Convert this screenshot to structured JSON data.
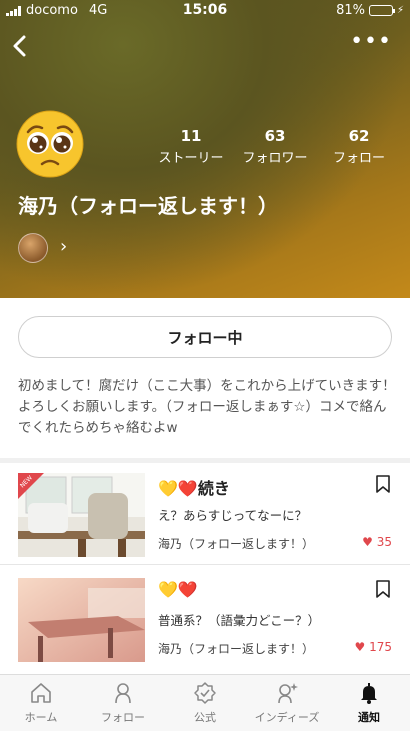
{
  "statusbar": {
    "carrier": "docomo",
    "network": "4G",
    "time": "15:06",
    "battery": "81%",
    "battery_level": 0.81
  },
  "profile": {
    "name": "海乃（フォロー返します！）",
    "stats": [
      {
        "value": "11",
        "label": "ストーリー"
      },
      {
        "value": "63",
        "label": "フォロワー"
      },
      {
        "value": "62",
        "label": "フォロー"
      }
    ],
    "avatar_icon": "pleading-face-emoji",
    "follow_button": "フォロー中",
    "bio": "初めまして！腐だけ（ここ大事）をこれから上げていきます！よろしくお願いします。（フォロー返しまぁす☆）コメで絡んでくれたらめちゃ絡むよw"
  },
  "stories": [
    {
      "title": "💛❤️続き",
      "description": "え？あらすじってなーに？",
      "author": "海乃（フォロー返します！）",
      "likes": "35",
      "badge": "NEW"
    },
    {
      "title": "💛❤️",
      "description": "普通系？（語彙力どこー？）",
      "author": "海乃（フォロー返します！）",
      "likes": "175"
    }
  ],
  "tabs": [
    {
      "label": "ホーム",
      "icon": "home-icon"
    },
    {
      "label": "フォロー",
      "icon": "person-icon"
    },
    {
      "label": "公式",
      "icon": "verified-badge-icon"
    },
    {
      "label": "インディーズ",
      "icon": "indies-icon"
    },
    {
      "label": "通知",
      "icon": "bell-icon",
      "active": true
    }
  ],
  "colors": {
    "accent_like": "#e0474c",
    "header_dark": "#4c4c22",
    "header_gold": "#c3891a"
  }
}
